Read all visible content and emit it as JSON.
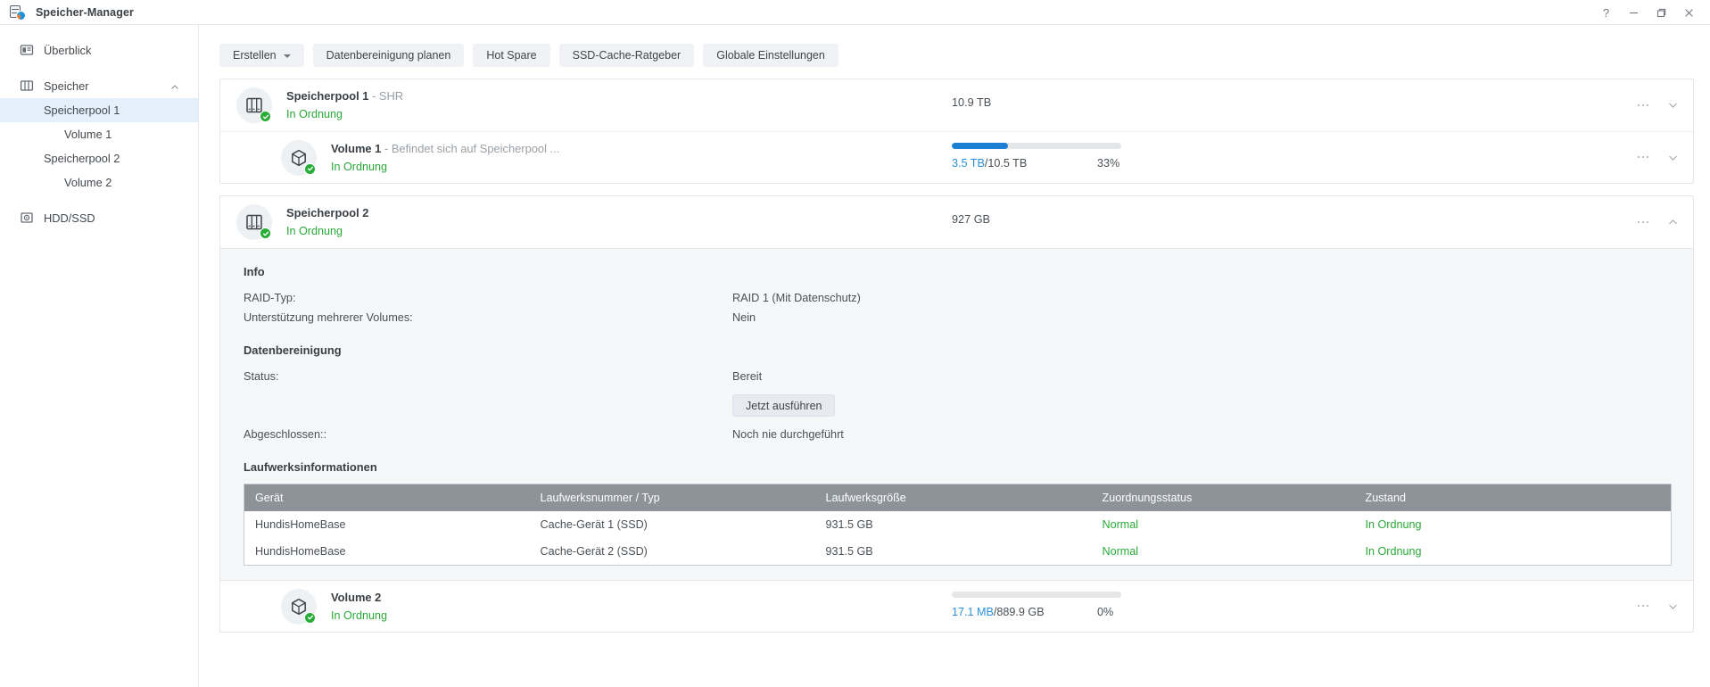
{
  "window": {
    "title": "Speicher-Manager",
    "app_icon": "storage-manager-icon",
    "controls": [
      {
        "name": "help-button",
        "glyph": "?"
      },
      {
        "name": "minimize-button",
        "glyph": "–"
      },
      {
        "name": "maximize-button",
        "glyph": "❐"
      },
      {
        "name": "close-button",
        "glyph": "✕"
      }
    ]
  },
  "sidebar": {
    "items": [
      {
        "label": "Überblick",
        "icon": "overview-icon",
        "level": 0,
        "selected": false
      },
      {
        "label": "Speicher",
        "icon": "storage-icon",
        "level": 0,
        "selected": false,
        "expanded": true
      },
      {
        "label": "Speicherpool 1",
        "icon": "",
        "level": 1,
        "selected": true
      },
      {
        "label": "Volume 1",
        "icon": "",
        "level": 2,
        "selected": false
      },
      {
        "label": "Speicherpool 2",
        "icon": "",
        "level": 1,
        "selected": false
      },
      {
        "label": "Volume 2",
        "icon": "",
        "level": 2,
        "selected": false
      },
      {
        "label": "HDD/SSD",
        "icon": "hdd-ssd-icon",
        "level": 0,
        "selected": false
      }
    ]
  },
  "toolbar": {
    "create_label": "Erstellen",
    "schedule_label": "Datenbereinigung planen",
    "hotspare_label": "Hot Spare",
    "ssdcache_label": "SSD-Cache-Ratgeber",
    "global_label": "Globale Einstellungen"
  },
  "pool1": {
    "name": "Speicherpool 1",
    "type_suffix": "- SHR",
    "status": "In Ordnung",
    "capacity": "10.9 TB",
    "volume": {
      "name": "Volume 1",
      "location_suffix": "- Befindet sich auf Speicherpool ...",
      "status": "In Ordnung",
      "used": "3.5 TB",
      "separator": " / ",
      "total": "10.5 TB",
      "percent_label": "33%",
      "percent_value": 33
    }
  },
  "pool2": {
    "name": "Speicherpool 2",
    "status": "In Ordnung",
    "capacity": "927 GB",
    "info": {
      "heading": "Info",
      "raid_key": "RAID-Typ:",
      "raid_value": "RAID 1 (Mit Datenschutz)",
      "multivol_key": "Unterstützung mehrerer Volumes:",
      "multivol_value": "Nein"
    },
    "scrub": {
      "heading": "Datenbereinigung",
      "status_key": "Status:",
      "status_value": "Bereit",
      "run_button": "Jetzt ausführen",
      "completed_key": "Abgeschlossen::",
      "completed_value": "Noch nie durchgeführt"
    },
    "drives": {
      "heading": "Laufwerksinformationen",
      "columns": [
        "Gerät",
        "Laufwerksnummer / Typ",
        "Laufwerksgröße",
        "Zuordnungsstatus",
        "Zustand"
      ],
      "rows": [
        {
          "device": "HundisHomeBase",
          "drive": "Cache-Gerät 1 (SSD)",
          "size": "931.5 GB",
          "alloc": "Normal",
          "health": "In Ordnung"
        },
        {
          "device": "HundisHomeBase",
          "drive": "Cache-Gerät 2 (SSD)",
          "size": "931.5 GB",
          "alloc": "Normal",
          "health": "In Ordnung"
        }
      ]
    },
    "volume": {
      "name": "Volume 2",
      "status": "In Ordnung",
      "used": "17.1 MB",
      "separator": " / ",
      "total": "889.9 GB",
      "percent_label": "0%",
      "percent_value": 0
    }
  },
  "colors": {
    "accent": "#1b7fd4",
    "ok_green": "#2aa838",
    "table_header": "#8d9398",
    "selected_nav": "#e3f0fb",
    "panel_bg": "#f5f7f9"
  }
}
